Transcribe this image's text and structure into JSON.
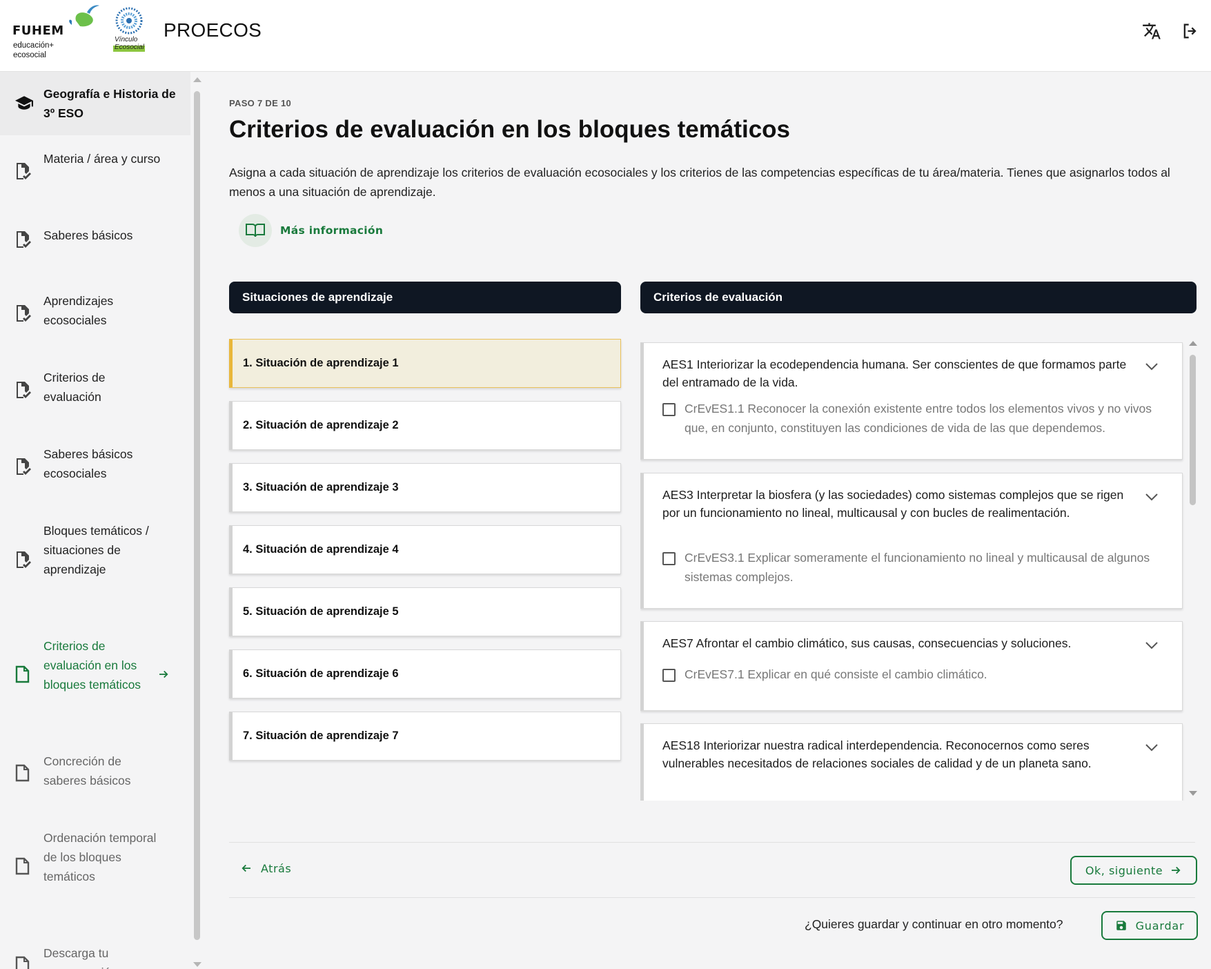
{
  "header": {
    "brand": "FUHEM",
    "brand_sub_line1": "educación+",
    "brand_sub_line2": "ecosocial",
    "vinculo_logo_text": "Vínculo Ecosocial",
    "app_title": "PROECOS",
    "translate_icon": "translate-icon",
    "logout_icon": "logout-icon"
  },
  "sidebar": {
    "course_title": "Geografía e Historia de 3º ESO",
    "items": [
      {
        "label": "Materia / área y curso",
        "state": "done"
      },
      {
        "label": "Saberes básicos",
        "state": "done"
      },
      {
        "label": "Aprendizajes ecosociales",
        "state": "done"
      },
      {
        "label": "Criterios de evaluación",
        "state": "done"
      },
      {
        "label": "Saberes básicos ecosociales",
        "state": "done"
      },
      {
        "label": "Bloques temáticos / situaciones de aprendizaje",
        "state": "done"
      },
      {
        "label": "Criterios de evaluación en los bloques temáticos",
        "state": "active"
      },
      {
        "label": "Concreción de saberes básicos",
        "state": "future"
      },
      {
        "label": "Ordenación temporal de los bloques temáticos",
        "state": "future"
      },
      {
        "label": "Descarga tu programación",
        "state": "future"
      }
    ]
  },
  "main": {
    "step": "PASO 7 DE 10",
    "title": "Criterios de evaluación en los bloques temáticos",
    "description": "Asigna a cada situación de aprendizaje los criterios de evaluación ecosociales y los criterios de las competencias específicas de tu área/materia. Tienes que asignarlos todos al menos a una situación de aprendizaje.",
    "more_info": "Más información",
    "situaciones_header": "Situaciones de aprendizaje",
    "criterios_header": "Criterios de evaluación",
    "situaciones": [
      "1.  Situación de aprendizaje 1",
      "2.  Situación de aprendizaje 2",
      "3.  Situación de aprendizaje 3",
      "4.  Situación de aprendizaje 4",
      "5.  Situación de aprendizaje 5",
      "6.  Situación de aprendizaje 6",
      "7.  Situación de aprendizaje 7"
    ],
    "selected_situacion": 1,
    "criterios": [
      {
        "title": "AES1 Interiorizar la ecodependencia humana. Ser conscientes de que formamos parte del entramado de la vida.",
        "sub": "CrEvES1.1 Reconocer la conexión existente entre todos los elementos vivos y no vivos que, en conjunto, constituyen las condiciones de vida de las que dependemos.",
        "checked": false
      },
      {
        "title": "AES3 Interpretar la biosfera (y las sociedades) como sistemas complejos que se rigen por un funcionamiento no lineal, multicausal y con bucles de realimentación.",
        "sub": "CrEvES3.1 Explicar someramente el funcionamiento no lineal y multicausal de algunos sistemas complejos.",
        "checked": false
      },
      {
        "title": "AES7 Afrontar el cambio climático, sus causas, consecuencias y soluciones.",
        "sub": "CrEvES7.1 Explicar en qué consiste el cambio climático.",
        "checked": false
      },
      {
        "title": "AES18 Interiorizar nuestra radical interdependencia. Reconocernos como seres vulnerables necesitados de relaciones sociales de calidad y de un planeta sano."
      }
    ]
  },
  "footer": {
    "back": "Atrás",
    "next": "Ok, siguiente",
    "save_question": "¿Quieres guardar y continuar en otro momento?",
    "save": "Guardar"
  },
  "colors": {
    "accent_green": "#197a3c",
    "header_dark": "#0f1723",
    "selected_bg": "#f2eedd",
    "selected_border": "#e9b73a"
  }
}
